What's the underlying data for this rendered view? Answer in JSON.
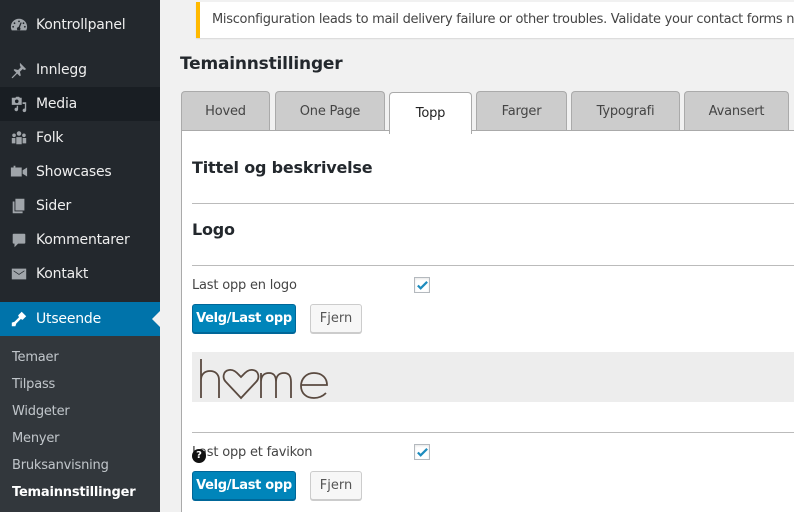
{
  "sidebar": {
    "items": [
      {
        "label": "Kontrollpanel",
        "icon": "dashboard-icon"
      },
      {
        "label": "Innlegg",
        "icon": "pushpin-icon"
      },
      {
        "label": "Media",
        "icon": "media-icon"
      },
      {
        "label": "Folk",
        "icon": "people-icon"
      },
      {
        "label": "Showcases",
        "icon": "video-camera-icon"
      },
      {
        "label": "Sider",
        "icon": "pages-icon"
      },
      {
        "label": "Kommentarer",
        "icon": "comment-icon"
      },
      {
        "label": "Kontakt",
        "icon": "envelope-icon"
      },
      {
        "label": "Utseende",
        "icon": "paintbrush-icon"
      }
    ],
    "submenu": [
      {
        "label": "Temaer"
      },
      {
        "label": "Tilpass"
      },
      {
        "label": "Widgeter"
      },
      {
        "label": "Menyer"
      },
      {
        "label": "Bruksanvisning"
      },
      {
        "label": "Temainnstillinger"
      }
    ]
  },
  "notice": {
    "text": "Misconfiguration leads to mail delivery failure or other troubles. Validate your contact forms now."
  },
  "page": {
    "title": "Temainnstillinger"
  },
  "tabs": [
    {
      "label": "Hoved"
    },
    {
      "label": "One Page"
    },
    {
      "label": "Topp",
      "active": true
    },
    {
      "label": "Farger"
    },
    {
      "label": "Typografi"
    },
    {
      "label": "Avansert"
    }
  ],
  "panel": {
    "section_title": "Tittel og beskrivelse",
    "logo_section": "Logo",
    "logo_field": {
      "label": "Last opp en logo",
      "checked": true,
      "upload_label": "Velg/Last opp",
      "remove_label": "Fjern",
      "preview_text": "home"
    },
    "favicon_field": {
      "label": "Last opp et favikon",
      "checked": true,
      "upload_label": "Velg/Last opp",
      "remove_label": "Fjern",
      "help_glyph": "?"
    }
  },
  "colors": {
    "sidebar_bg": "#23282d",
    "accent": "#0073aa",
    "button_primary": "#0085ba",
    "notice_border": "#ffb900"
  }
}
